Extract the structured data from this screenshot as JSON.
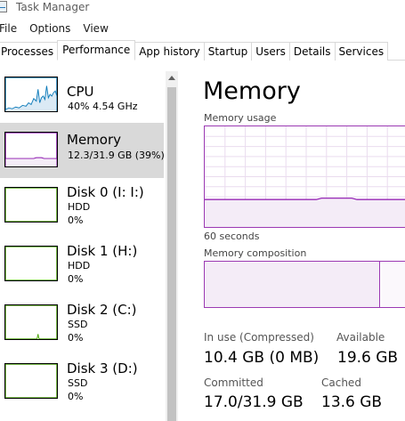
{
  "window": {
    "title": "Task Manager"
  },
  "menu": [
    "File",
    "Options",
    "View"
  ],
  "tabs": [
    {
      "label": "Processes",
      "active": false
    },
    {
      "label": "Performance",
      "active": true
    },
    {
      "label": "App history",
      "active": false
    },
    {
      "label": "Startup",
      "active": false
    },
    {
      "label": "Users",
      "active": false
    },
    {
      "label": "Details",
      "active": false
    },
    {
      "label": "Services",
      "active": false
    }
  ],
  "sidebar": {
    "items": [
      {
        "name": "CPU",
        "line1": "40%  4.54 GHz",
        "line2": "",
        "color": "#117dbb",
        "selected": false
      },
      {
        "name": "Memory",
        "line1": "12.3/31.9 GB (39%)",
        "line2": "",
        "color": "#8b12ae",
        "selected": true
      },
      {
        "name": "Disk 0 (I: I:)",
        "line1": "HDD",
        "line2": "0%",
        "color": "#4da60c",
        "selected": false
      },
      {
        "name": "Disk 1 (H:)",
        "line1": "HDD",
        "line2": "0%",
        "color": "#4da60c",
        "selected": false
      },
      {
        "name": "Disk 2 (C:)",
        "line1": "SSD",
        "line2": "0%",
        "color": "#4da60c",
        "selected": false
      },
      {
        "name": "Disk 3 (D:)",
        "line1": "SSD",
        "line2": "0%",
        "color": "#4da60c",
        "selected": false
      }
    ]
  },
  "main": {
    "title": "Memory",
    "usage_label": "Memory usage",
    "time_label": "60 seconds",
    "composition_label": "Memory composition",
    "stats": {
      "in_use_label": "In use (Compressed)",
      "in_use_value": "10.4 GB (0 MB)",
      "available_label": "Available",
      "available_value": "19.6 GB",
      "committed_label": "Committed",
      "committed_value": "17.0/31.9 GB",
      "cached_label": "Cached",
      "cached_value": "13.6 GB"
    },
    "memory_usage_fraction": 0.39,
    "composition_in_use_fraction": 0.39
  }
}
